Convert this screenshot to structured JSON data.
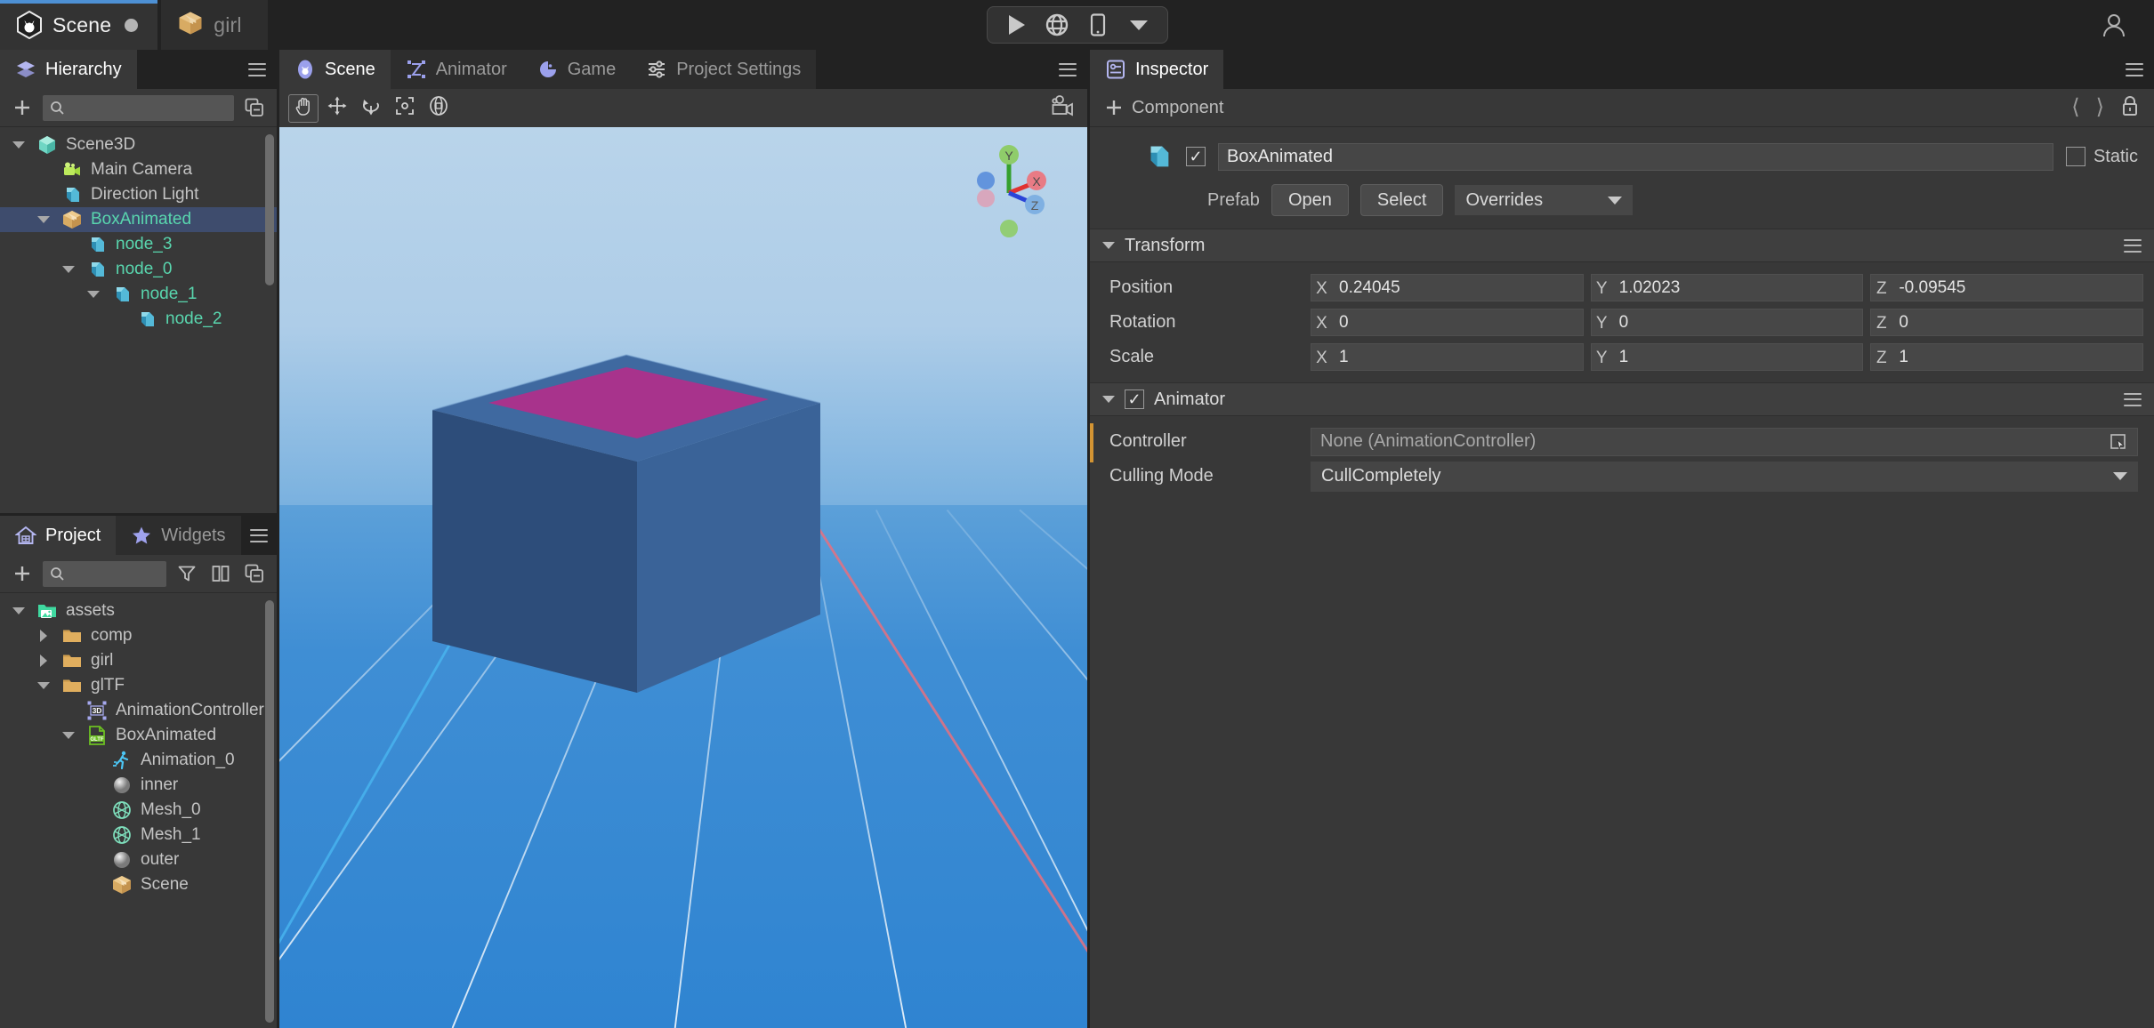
{
  "topbar": {
    "doc_tabs": [
      {
        "label": "Scene",
        "icon": "scene-hex-icon",
        "active": true,
        "dirty": true
      },
      {
        "label": "girl",
        "icon": "prefab-box-icon",
        "active": false,
        "dirty": false
      }
    ],
    "play_controls": [
      {
        "name": "play-button",
        "icon": "play-icon"
      },
      {
        "name": "preview-web-button",
        "icon": "globe-icon"
      },
      {
        "name": "preview-device-button",
        "icon": "phone-icon"
      },
      {
        "name": "preview-options-button",
        "icon": "chevron-down-icon"
      }
    ],
    "account_icon": "user-icon"
  },
  "hierarchy": {
    "tab_label": "Hierarchy",
    "tab_icon": "layers-icon",
    "menu_icon": "hamburger-icon",
    "add_icon": "plus-icon",
    "search_placeholder": "",
    "search_value": "",
    "collapse_icon": "collapse-all-icon",
    "items": [
      {
        "label": "Scene3D",
        "depth": 0,
        "caret": "down",
        "icon": "scene-cube-icon",
        "selected": false,
        "prefab": false
      },
      {
        "label": "Main Camera",
        "depth": 1,
        "caret": "none",
        "icon": "camera-icon",
        "selected": false,
        "prefab": false
      },
      {
        "label": "Direction Light",
        "depth": 1,
        "caret": "none",
        "icon": "node-cube-icon",
        "selected": false,
        "prefab": false
      },
      {
        "label": "BoxAnimated",
        "depth": 1,
        "caret": "down",
        "icon": "prefab-box-icon",
        "selected": true,
        "prefab": true
      },
      {
        "label": "node_3",
        "depth": 2,
        "caret": "none",
        "icon": "node-cube-icon",
        "selected": false,
        "prefab": true
      },
      {
        "label": "node_0",
        "depth": 2,
        "caret": "down",
        "icon": "node-cube-icon",
        "selected": false,
        "prefab": true
      },
      {
        "label": "node_1",
        "depth": 3,
        "caret": "down",
        "icon": "node-cube-icon",
        "selected": false,
        "prefab": true
      },
      {
        "label": "node_2",
        "depth": 4,
        "caret": "none",
        "icon": "node-cube-icon",
        "selected": false,
        "prefab": true
      }
    ]
  },
  "project": {
    "tabs": [
      {
        "label": "Project",
        "icon": "home-icon",
        "active": true
      },
      {
        "label": "Widgets",
        "icon": "star-icon",
        "active": false
      }
    ],
    "menu_icon": "hamburger-icon",
    "add_icon": "plus-icon",
    "search_placeholder": "",
    "search_value": "",
    "filter_icon": "funnel-icon",
    "columns_icon": "two-column-icon",
    "collapse_icon": "collapse-all-icon",
    "items": [
      {
        "label": "assets",
        "depth": 0,
        "caret": "down",
        "icon": "assets-folder-icon"
      },
      {
        "label": "comp",
        "depth": 1,
        "caret": "right",
        "icon": "folder-icon"
      },
      {
        "label": "girl",
        "depth": 1,
        "caret": "right",
        "icon": "folder-icon"
      },
      {
        "label": "glTF",
        "depth": 1,
        "caret": "down",
        "icon": "folder-icon"
      },
      {
        "label": "AnimationController",
        "depth": 2,
        "caret": "none",
        "icon": "anim-controller-icon"
      },
      {
        "label": "BoxAnimated",
        "depth": 2,
        "caret": "down",
        "icon": "gltf-file-icon"
      },
      {
        "label": "Animation_0",
        "depth": 3,
        "caret": "none",
        "icon": "animation-clip-icon"
      },
      {
        "label": "inner",
        "depth": 3,
        "caret": "none",
        "icon": "material-sphere-icon"
      },
      {
        "label": "Mesh_0",
        "depth": 3,
        "caret": "none",
        "icon": "mesh-icon"
      },
      {
        "label": "Mesh_1",
        "depth": 3,
        "caret": "none",
        "icon": "mesh-icon"
      },
      {
        "label": "outer",
        "depth": 3,
        "caret": "none",
        "icon": "material-sphere-icon"
      },
      {
        "label": "Scene",
        "depth": 3,
        "caret": "none",
        "icon": "prefab-box-icon"
      }
    ]
  },
  "scene_panel": {
    "tabs": [
      {
        "label": "Scene",
        "icon": "scene-view-icon",
        "active": true
      },
      {
        "label": "Animator",
        "icon": "animator-icon",
        "active": false
      },
      {
        "label": "Game",
        "icon": "game-icon",
        "active": false
      },
      {
        "label": "Project Settings",
        "icon": "settings-sliders-icon",
        "active": false
      }
    ],
    "menu_icon": "hamburger-icon",
    "tools": [
      {
        "name": "pan-tool",
        "icon": "hand-icon",
        "active": true
      },
      {
        "name": "move-tool",
        "icon": "move-arrows-icon",
        "active": false
      },
      {
        "name": "rotate-tool",
        "icon": "rotate-icon",
        "active": false
      },
      {
        "name": "scale-tool",
        "icon": "scale-icon",
        "active": false
      },
      {
        "name": "global-tool",
        "icon": "global-pivot-icon",
        "active": false
      }
    ],
    "camera_icon": "scene-camera-icon",
    "gizmo": {
      "x_label": "X",
      "y_label": "Y",
      "z_label": "Z",
      "x_color": "#e03232",
      "y_color": "#35a02e",
      "z_color": "#2a44d8"
    },
    "viewport": {
      "sky_top": "#b9d4ea",
      "ground_color": "#3f8ed4",
      "grid_color": "#ffffff",
      "axis_x_color": "#e8707f",
      "axis_z_color": "#49b6f0",
      "cube_front": "#2d4d7a",
      "cube_right": "#3a6398",
      "cube_top": "#3f69a0",
      "cube_inner_top": "#a8338c"
    }
  },
  "inspector": {
    "tab_label": "Inspector",
    "tab_icon": "inspector-icon",
    "menu_icon": "hamburger-icon",
    "add_component_label": "Component",
    "add_component_icon": "plus-icon",
    "nav_back_icon": "chevron-left-icon",
    "nav_forward_icon": "chevron-right-icon",
    "lock_icon": "lock-icon",
    "object": {
      "icon": "node-cube-icon",
      "enabled": true,
      "name": "BoxAnimated",
      "static_label": "Static",
      "static_checked": false
    },
    "prefab": {
      "label": "Prefab",
      "open_label": "Open",
      "select_label": "Select",
      "overrides_label": "Overrides"
    },
    "components": [
      {
        "name": "Transform",
        "has_checkbox": false,
        "enabled": true,
        "expanded": true,
        "accent": false,
        "fields": [
          {
            "type": "vector3",
            "label": "Position",
            "axes": [
              "X",
              "Y",
              "Z"
            ],
            "values": [
              "0.24045",
              "1.02023",
              "-0.09545"
            ]
          },
          {
            "type": "vector3",
            "label": "Rotation",
            "axes": [
              "X",
              "Y",
              "Z"
            ],
            "values": [
              "0",
              "0",
              "0"
            ]
          },
          {
            "type": "vector3",
            "label": "Scale",
            "axes": [
              "X",
              "Y",
              "Z"
            ],
            "values": [
              "1",
              "1",
              "1"
            ]
          }
        ]
      },
      {
        "name": "Animator",
        "has_checkbox": true,
        "enabled": true,
        "expanded": true,
        "accent": true,
        "accent_color": "#d39433",
        "fields": [
          {
            "type": "object",
            "label": "Controller",
            "value": "None (AnimationController)",
            "picker_icon": "object-picker-icon"
          },
          {
            "type": "enum",
            "label": "Culling Mode",
            "value": "CullCompletely"
          }
        ]
      }
    ]
  }
}
